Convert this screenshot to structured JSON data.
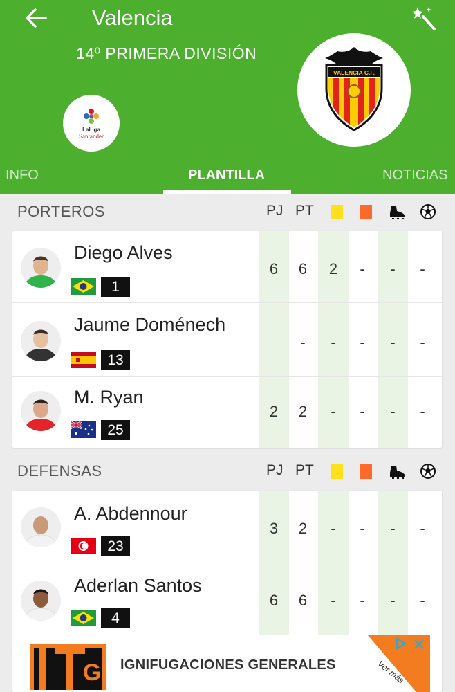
{
  "header": {
    "title": "Valencia",
    "league_info": "14º PRIMERA DIVISIÓN",
    "league_logo_text_1": "LaLiga",
    "league_logo_text_2": "Santander",
    "club_crest_text": "VALENCIA C.F.",
    "back_icon": "back-arrow-icon",
    "magic_icon": "magic-wand-icon",
    "color": "#4caf2d"
  },
  "tabs": [
    {
      "label": "INFO",
      "active": false
    },
    {
      "label": "PLANTILLA",
      "active": true
    },
    {
      "label": "NOTICIAS",
      "active": false
    }
  ],
  "columns": {
    "pj": "PJ",
    "pt": "PT",
    "yellow_card": "#ffe01a",
    "red_card": "#ff6a2b",
    "boot_icon": "boot-icon",
    "ball_icon": "ball-icon"
  },
  "sections": [
    {
      "title": "PORTEROS",
      "players": [
        {
          "name": "Diego Alves",
          "number": "1",
          "flag": "brazil",
          "pj": "6",
          "pt": "6",
          "yc": "2",
          "rc": "-",
          "assists": "-",
          "goals": "-"
        },
        {
          "name": "Jaume Doménech",
          "number": "13",
          "flag": "spain",
          "pj": "",
          "pt": "-",
          "yc": "-",
          "rc": "-",
          "assists": "-",
          "goals": "-"
        },
        {
          "name": "M. Ryan",
          "number": "25",
          "flag": "australia",
          "pj": "2",
          "pt": "2",
          "yc": "-",
          "rc": "-",
          "assists": "-",
          "goals": "-"
        }
      ]
    },
    {
      "title": "DEFENSAS",
      "players": [
        {
          "name": "A. Abdennour",
          "number": "23",
          "flag": "tunisia",
          "pj": "3",
          "pt": "2",
          "yc": "-",
          "rc": "-",
          "assists": "-",
          "goals": "-"
        },
        {
          "name": "Aderlan Santos",
          "number": "4",
          "flag": "brazil",
          "pj": "6",
          "pt": "6",
          "yc": "-",
          "rc": "-",
          "assists": "-",
          "goals": "-"
        }
      ]
    }
  ],
  "ad": {
    "logo_text": "IG",
    "text": "IGNIFUGACIONES GENERALES",
    "more": "Ver más"
  }
}
